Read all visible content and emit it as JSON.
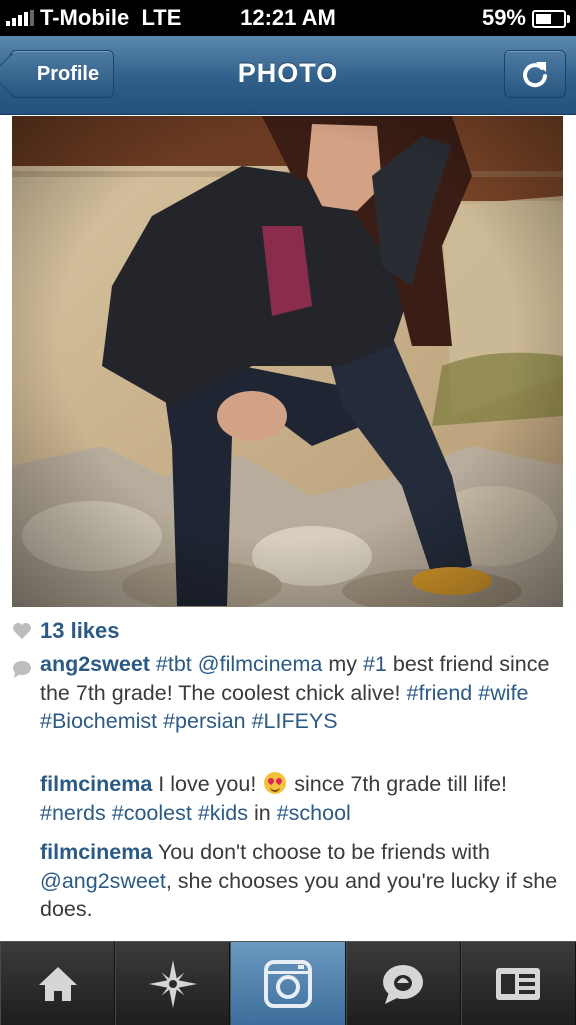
{
  "status_bar": {
    "carrier": "T-Mobile",
    "network": "LTE",
    "time": "12:21 AM",
    "battery": "59%",
    "battery_level": 0.59
  },
  "nav": {
    "back_label": "Profile",
    "title": "PHOTO"
  },
  "post": {
    "likes": "13 likes",
    "comments": [
      {
        "user": "ang2sweet",
        "parts": [
          {
            "t": " ",
            "tag": false
          },
          {
            "t": "#tbt",
            "tag": true
          },
          {
            "t": " ",
            "tag": false
          },
          {
            "t": "@filmcinema",
            "tag": true
          },
          {
            "t": " my ",
            "tag": false
          },
          {
            "t": "#1",
            "tag": true
          },
          {
            "t": " best friend since the 7th grade! The coolest chick alive! ",
            "tag": false
          },
          {
            "t": "#friend",
            "tag": true
          },
          {
            "t": " ",
            "tag": false
          },
          {
            "t": "#wife",
            "tag": true
          },
          {
            "t": " ",
            "tag": false
          },
          {
            "t": "#Biochemist",
            "tag": true
          },
          {
            "t": " ",
            "tag": false
          },
          {
            "t": "#persian",
            "tag": true
          },
          {
            "t": " ",
            "tag": false
          },
          {
            "t": "#LIFEYS",
            "tag": true
          }
        ]
      },
      {
        "user": "filmcinema",
        "parts_before_emoji": " I love you! ",
        "parts": [
          {
            "t": " since 7th grade till life! ",
            "tag": false
          },
          {
            "t": "#nerds",
            "tag": true
          },
          {
            "t": " ",
            "tag": false
          },
          {
            "t": "#coolest",
            "tag": true
          },
          {
            "t": " ",
            "tag": false
          },
          {
            "t": "#kids",
            "tag": true
          },
          {
            "t": " in ",
            "tag": false
          },
          {
            "t": "#school",
            "tag": true
          }
        ]
      },
      {
        "user": "filmcinema",
        "parts": [
          {
            "t": " You don't choose to be friends with ",
            "tag": false
          },
          {
            "t": "@ang2sweet",
            "tag": true
          },
          {
            "t": ", she chooses you and you're lucky if she does.",
            "tag": false
          }
        ]
      }
    ]
  },
  "tabs": [
    {
      "icon": "home-icon"
    },
    {
      "icon": "explore-icon"
    },
    {
      "icon": "camera-icon"
    },
    {
      "icon": "news-icon"
    },
    {
      "icon": "profile-icon"
    }
  ],
  "colors": {
    "nav_blue": "#2f5f8a",
    "link_blue": "#2b5a86",
    "camera_tab": "#4f80ab"
  }
}
